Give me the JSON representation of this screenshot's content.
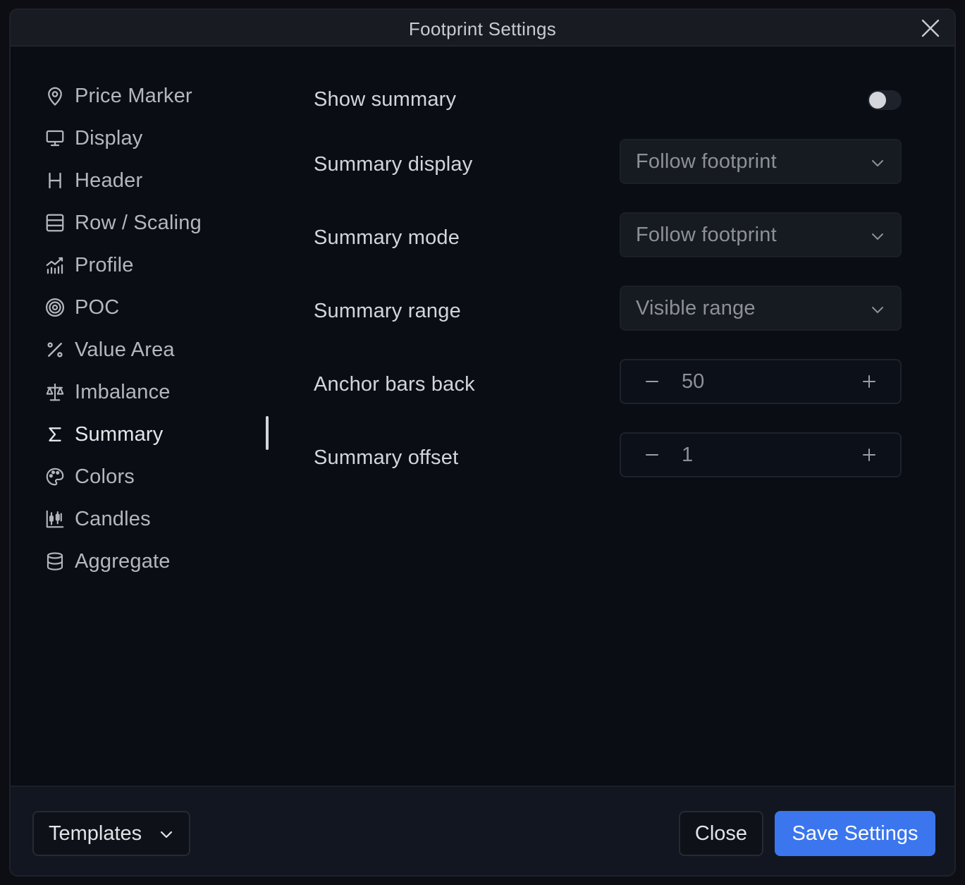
{
  "dialog": {
    "title": "Footprint Settings",
    "close_icon": "close-icon"
  },
  "sidebar": {
    "active_index": 8,
    "items": [
      {
        "label": "Price Marker",
        "icon": "map-pin-icon"
      },
      {
        "label": "Display",
        "icon": "monitor-icon"
      },
      {
        "label": "Header",
        "icon": "heading-icon"
      },
      {
        "label": "Row / Scaling",
        "icon": "rows-icon"
      },
      {
        "label": "Profile",
        "icon": "chart-profile-icon"
      },
      {
        "label": "POC",
        "icon": "target-icon"
      },
      {
        "label": "Value Area",
        "icon": "percent-icon"
      },
      {
        "label": "Imbalance",
        "icon": "scale-icon"
      },
      {
        "label": "Summary",
        "icon": "sigma-icon"
      },
      {
        "label": "Colors",
        "icon": "palette-icon"
      },
      {
        "label": "Candles",
        "icon": "candlestick-icon"
      },
      {
        "label": "Aggregate",
        "icon": "database-icon"
      }
    ]
  },
  "settings": {
    "show_summary": {
      "label": "Show summary",
      "enabled": false
    },
    "summary_display": {
      "label": "Summary display",
      "value": "Follow footprint"
    },
    "summary_mode": {
      "label": "Summary mode",
      "value": "Follow footprint"
    },
    "summary_range": {
      "label": "Summary range",
      "value": "Visible range"
    },
    "anchor_bars_back": {
      "label": "Anchor bars back",
      "value": "50"
    },
    "summary_offset": {
      "label": "Summary offset",
      "value": "1"
    }
  },
  "footer": {
    "templates_label": "Templates",
    "close_label": "Close",
    "save_label": "Save Settings"
  },
  "colors": {
    "accent": "#3b76ee",
    "background": "#0a0d14",
    "titlebar": "#181b22"
  }
}
